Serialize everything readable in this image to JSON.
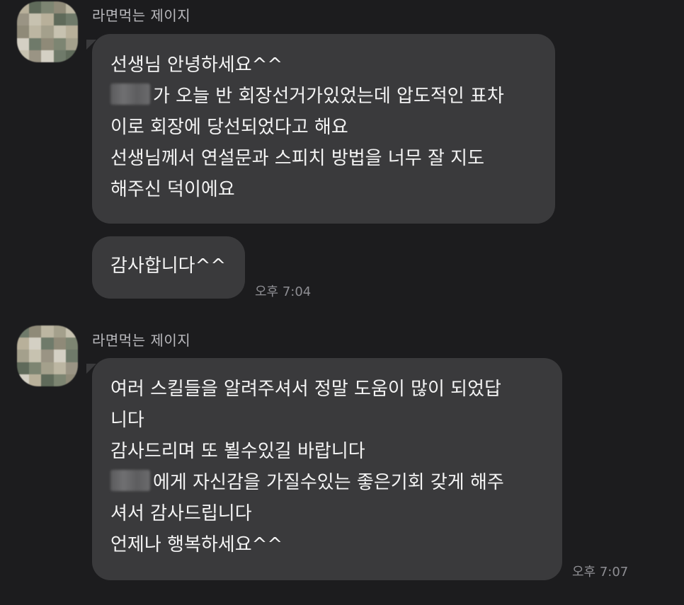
{
  "chat": {
    "groups": [
      {
        "sender": "라면먹는 제이지",
        "messages": [
          {
            "lines": [
              "선생님 안녕하세요^^",
              "가 오늘 반 회장선거가있었는데 압도적인 표차",
              "이로 회장에 당선되었다고 해요",
              "선생님께서 연설문과 스피치 방법을 너무 잘 지도",
              "해주신 덕이에요"
            ]
          },
          {
            "lines": [
              "감사합니다^^"
            ],
            "time": "오후 7:04"
          }
        ]
      },
      {
        "sender": "라면먹는 제이지",
        "messages": [
          {
            "lines": [
              "여러 스킬들을 알려주셔서 정말 도움이 많이 되었답",
              "니다",
              "감사드리며 또 뵐수있길 바랍니다",
              "에게 자신감을 가질수있는 좋은기회 갖게 해주",
              "셔서 감사드립니다",
              "언제나 행복하세요^^"
            ],
            "time": "오후 7:07"
          }
        ]
      }
    ]
  }
}
